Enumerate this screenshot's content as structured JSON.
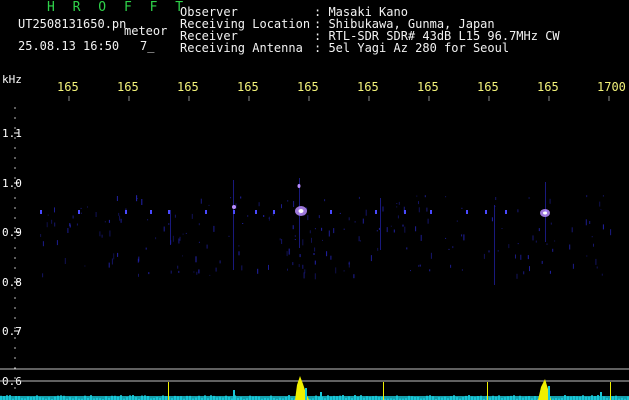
{
  "header": {
    "app_name": "H R O F F T",
    "filename": "UT2508131650.pn",
    "mode": "meteor",
    "datetime": "25.08.13 16:50",
    "counter": "7_",
    "info_labels": {
      "observer": "Observer",
      "location": "Receiving Location",
      "receiver": "Receiver",
      "antenna": "Receiving Antenna"
    },
    "info_values": {
      "observer": ": Masaki Kano",
      "location": ": Shibukawa, Gunma, Japan",
      "receiver": ": RTL-SDR SDR# 43dB L15 96.7MHz CW",
      "antenna": ": 5el Yagi Az 280 for Seoul"
    }
  },
  "chart_data": {
    "type": "heatmap",
    "ylabel": "kHz",
    "y_ticks": [
      "1.1",
      "1.0",
      "0.9",
      "0.8",
      "0.7",
      "0.6"
    ],
    "x_ticks": [
      "165",
      "165",
      "165",
      "165",
      "165",
      "165",
      "165",
      "165",
      "165",
      "1700"
    ],
    "colors": {
      "background": "#000000",
      "faint": "#2a2ad0",
      "medium": "#4a4aff",
      "strong": "#b88cff",
      "peak": "#ffffff",
      "meter_cyan": "#19c8d8",
      "meter_yellow": "#f0f000",
      "tick_labels": "#f3f37a"
    }
  }
}
